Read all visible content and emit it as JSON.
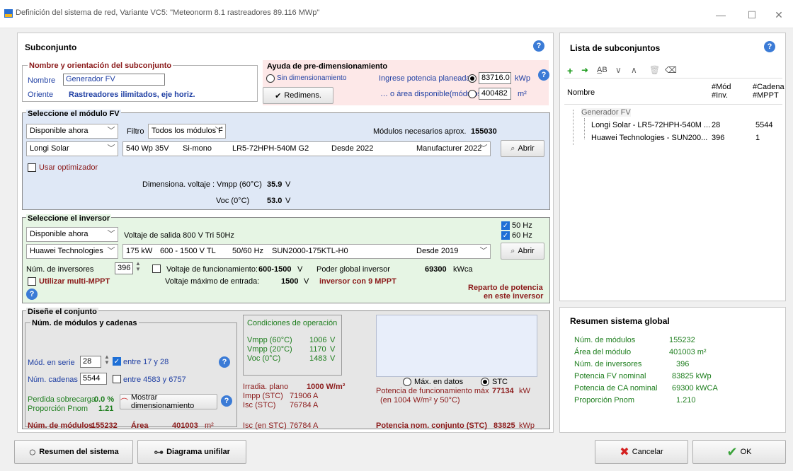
{
  "window": {
    "title": "Definición del sistema de red, Variante VC5:  \"Meteonorm 8.1 rastreadores 89.116 MWp\"",
    "minimize": "—",
    "maximize": "☐",
    "close": "✕"
  },
  "subset": {
    "heading": "Subconjunto",
    "name_group": "Nombre y orientación del subconjunto",
    "name_label": "Nombre",
    "name_value": "Generador FV",
    "orient_label": "Oriente",
    "orient_value": "Rastreadores ilimitados, eje horiz."
  },
  "presize": {
    "heading": "Ayuda de pre-dimensionamiento",
    "no_sizing": "Sin dimensionamiento",
    "power_label": "Ingrese potencia planeada",
    "power_value": "83716.0",
    "power_unit": "kWp",
    "area_label": "… o área disponible(módulos)",
    "area_value": "400482",
    "area_unit": "m²",
    "resize_button": "Redimens."
  },
  "module": {
    "heading": "Seleccione el módulo FV",
    "availability": "Disponible ahora",
    "filter_label": "Filtro",
    "filter_value": "Todos los módulos F",
    "needed_label": "Módulos necesarios aprox.",
    "needed_value": "155030",
    "maker": "Longi Solar",
    "spec_power": "540 Wp 35V",
    "spec_tech": "Si-mono",
    "spec_model": "LR5-72HPH-540M G2",
    "spec_since": "Desde 2022",
    "spec_source": "Manufacturer 2022",
    "open_button": "Abrir",
    "optimizer_label": "Usar optimizador",
    "vmpp_label": "Dimensiona. voltaje : Vmpp (60°C)",
    "vmpp_value": "35.9",
    "voc_label": "Voc (0°C)",
    "voc_value": "53.0",
    "volt_unit": "V"
  },
  "inverter": {
    "heading": "Seleccione el inversor",
    "availability": "Disponible ahora",
    "output_voltage": "Voltaje de salida 800 V Tri 50Hz",
    "hz50": "50 Hz",
    "hz60": "60 Hz",
    "maker": "Huawei Technologies",
    "spec_power": "175 kW",
    "spec_range": "600 - 1500 V TL",
    "spec_freq": "50/60 Hz",
    "spec_model": "SUN2000-175KTL-H0",
    "spec_since": "Desde 2019",
    "open_button": "Abrir",
    "count_label": "Núm. de inversores",
    "count_value": "396",
    "op_voltage_label": "Voltaje de funcionamiento:",
    "op_voltage_value": "600-1500",
    "global_power_label": "Poder global inversor",
    "global_power_value": "69300",
    "global_power_unit": "kWca",
    "multi_mppt_label": "Utilizar multi-MPPT",
    "max_input_label": "Voltaje máximo de entrada:",
    "max_input_value": "1500",
    "mppt_note": "inversor con 9 MPPT",
    "distribution_line1": "Reparto de potencia",
    "distribution_line2": "en este inversor",
    "volt_unit": "V"
  },
  "design": {
    "heading": "Diseñe el conjunto",
    "modules_group": "Núm. de módulos y cadenas",
    "series_label": "Mód. en serie",
    "series_value": "28",
    "series_range": "entre 17 y 28",
    "strings_label": "Núm. cadenas",
    "strings_value": "5544",
    "strings_range": "entre 4583 y 6757",
    "overload_label": "Perdida sobrecarga",
    "overload_value": "0.0 %",
    "pnom_label": "Proporción Pnom",
    "pnom_value": "1.21",
    "show_sizing_button": "Mostrar dimensionamiento",
    "nmod_label": "Núm. de módulos",
    "nmod_value": "155232",
    "area_label": "Área",
    "area_value": "401003",
    "area_unit": "m²",
    "cond_title": "Condiciones de operación",
    "cond_vmpp60_label": "Vmpp (60°C)",
    "cond_vmpp60_value": "1006",
    "cond_vmpp20_label": "Vmpp (20°C)",
    "cond_vmpp20_value": "1170",
    "cond_voc_label": "Voc (0°C)",
    "cond_voc_value": "1483",
    "volt_unit": "V",
    "irr_label": "Irradia. plano",
    "irr_value": "1000 W/m²",
    "impp_label": "Impp (STC)",
    "impp_value": "71906 A",
    "isc_label": "Isc (STC)",
    "isc_value": "76784 A",
    "isc_at_stc_label": "Isc (en STC)",
    "isc_at_stc_value": "76784 A",
    "max_data_label": "Máx. en datos",
    "stc_label": "STC",
    "op_power_label": "Potencia de funcionamiento máx",
    "op_power_value": "77134",
    "op_power_unit": "kW",
    "op_power_cond": "(en 1004 W/m²  y 50°C)",
    "nom_power_label": "Potencia nom. conjunto (STC)",
    "nom_power_value": "83825",
    "nom_power_unit": "kWp"
  },
  "subset_list": {
    "heading": "Lista de subconjuntos",
    "col_name": "Nombre",
    "col_mod1": "#Mód",
    "col_mod2": "#Inv.",
    "col_str1": "#Cadena",
    "col_str2": "#MPPT",
    "root": "Generador FV",
    "rows": [
      {
        "name": "Longi Solar - LR5-72HPH-540M ...",
        "a": "28",
        "b": "5544"
      },
      {
        "name": "Huawei Technologies - SUN200...",
        "a": "396",
        "b": "1"
      }
    ]
  },
  "summary": {
    "heading": "Resumen sistema global",
    "items": [
      {
        "label": "Núm. de módulos",
        "value": "155232"
      },
      {
        "label": "Área del módulo",
        "value": "401003 m²"
      },
      {
        "label": "Núm. de inversores",
        "value": "396"
      },
      {
        "label": "Potencia FV nominal",
        "value": "83825 kWp"
      },
      {
        "label": "Potencia de CA nominal",
        "value": "69300 kWCA"
      },
      {
        "label": "Proporción Pnom",
        "value": "1.210"
      }
    ]
  },
  "footer": {
    "summary_button": "Resumen del sistema",
    "diagram_button": "Diagrama unifilar",
    "cancel_button": "Cancelar",
    "ok_button": "OK"
  }
}
